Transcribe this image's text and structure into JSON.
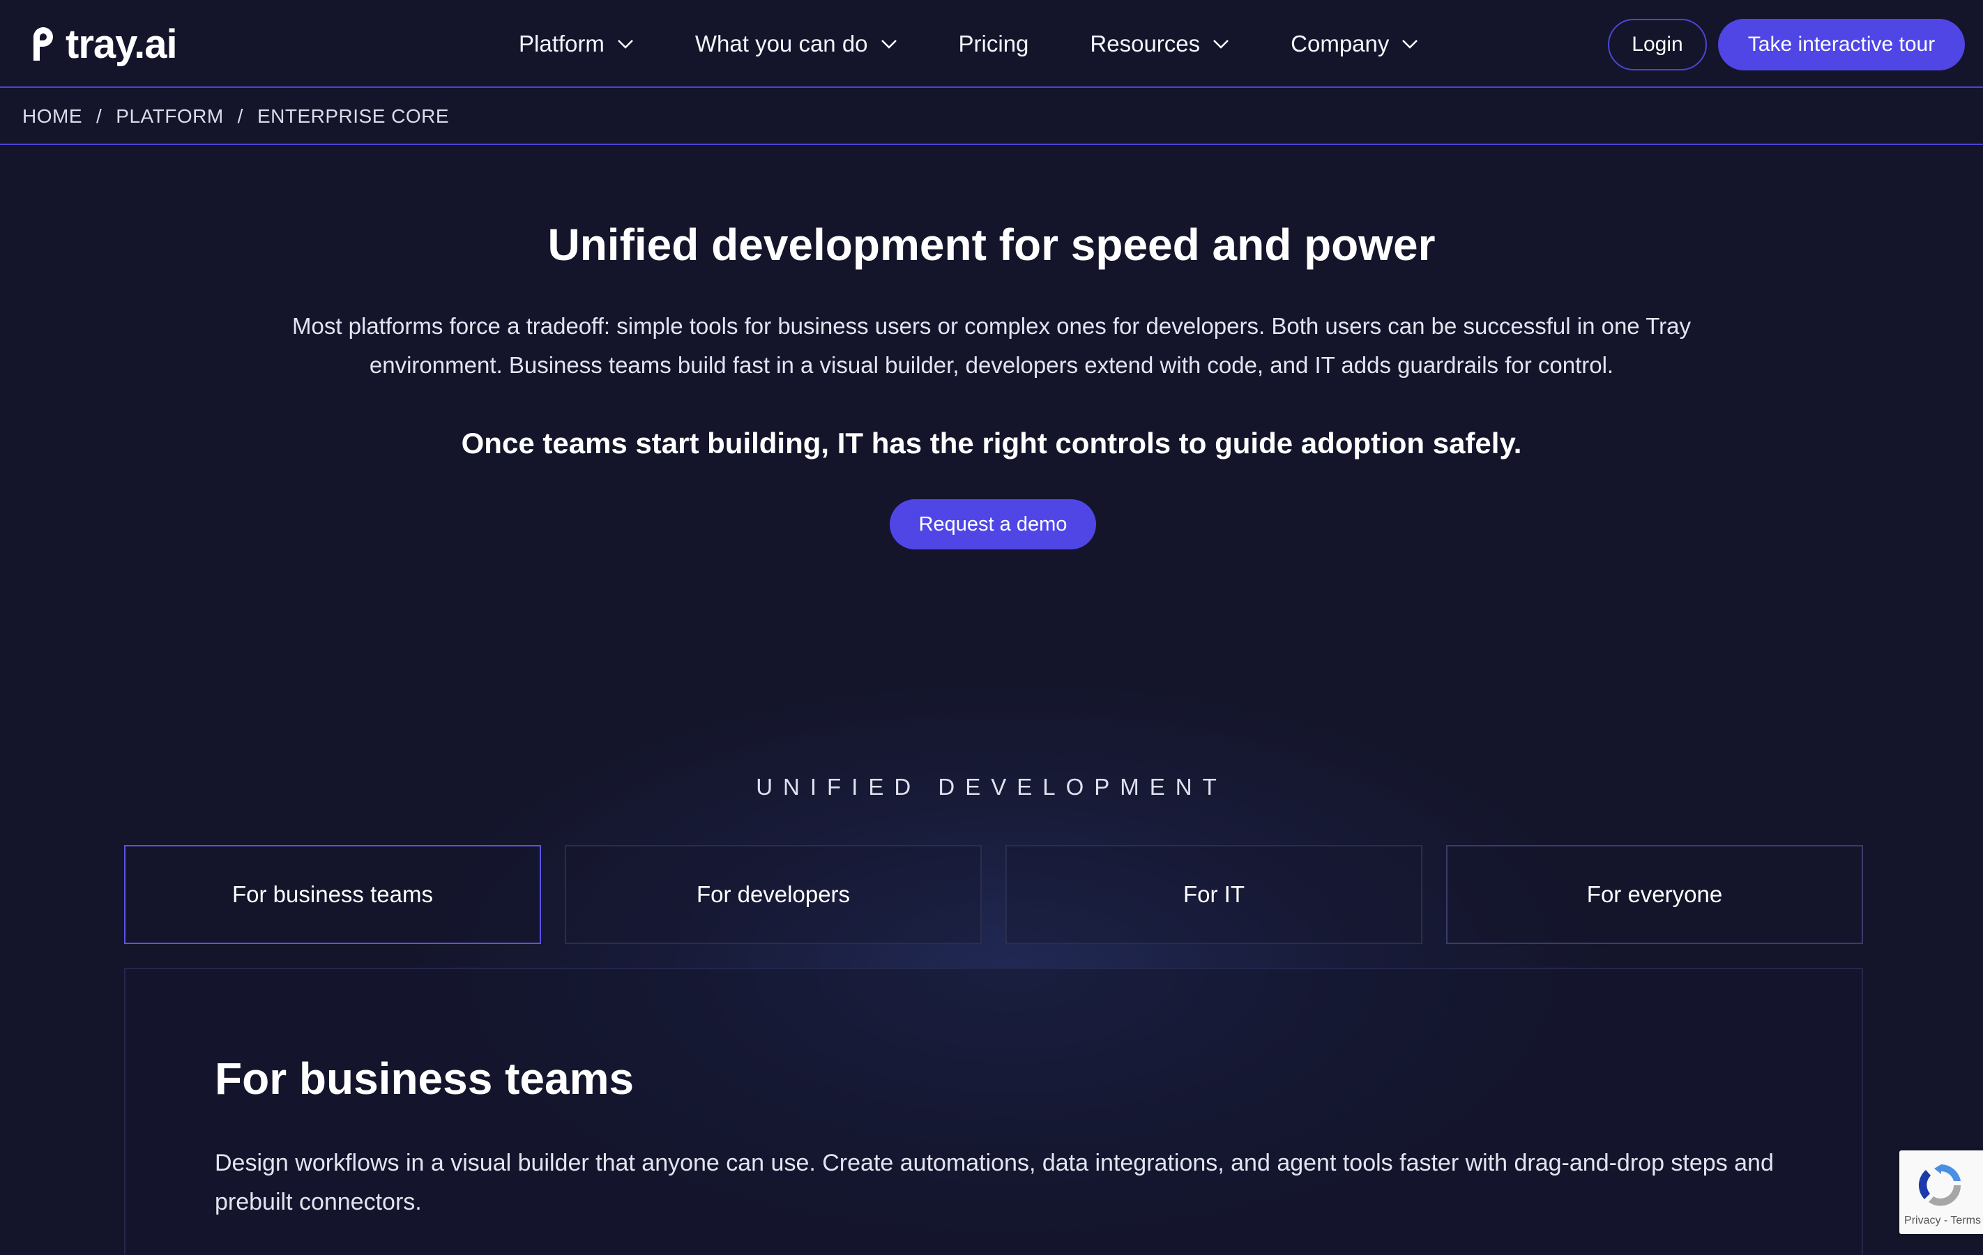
{
  "brand": {
    "name": "tray.ai",
    "logo_icon": "tray-link-icon"
  },
  "nav": {
    "items": [
      {
        "label": "Platform",
        "has_dropdown": true
      },
      {
        "label": "What you can do",
        "has_dropdown": true
      },
      {
        "label": "Pricing",
        "has_dropdown": false
      },
      {
        "label": "Resources",
        "has_dropdown": true
      },
      {
        "label": "Company",
        "has_dropdown": true
      }
    ],
    "login_label": "Login",
    "tour_label": "Take interactive tour"
  },
  "breadcrumb": {
    "items": [
      "HOME",
      "PLATFORM",
      "ENTERPRISE CORE"
    ],
    "separator": "/"
  },
  "hero": {
    "title": "Unified development for speed and power",
    "description": "Most platforms force a tradeoff: simple tools for business users or complex ones for developers. Both users can be successful in one Tray environment. Business teams build fast in a visual builder, developers extend with code, and IT adds guardrails for control.",
    "subtitle": "Once teams start building, IT has the right controls to guide adoption safely.",
    "cta_label": "Request a demo"
  },
  "unified": {
    "eyebrow": "UNIFIED DEVELOPMENT",
    "tabs": [
      {
        "label": "For business teams",
        "active": true
      },
      {
        "label": "For developers",
        "active": false
      },
      {
        "label": "For IT",
        "active": false
      },
      {
        "label": "For everyone",
        "active": false
      }
    ],
    "panel": {
      "title": "For business teams",
      "text": "Design workflows in a visual builder that anyone can use. Create automations, data integrations, and agent tools faster with drag-and-drop steps and prebuilt connectors."
    }
  },
  "recaptcha": {
    "links": "Privacy - Terms"
  },
  "colors": {
    "background": "#14152b",
    "accent": "#4f46e5",
    "divider": "#4b45d6",
    "text": "#ffffff"
  }
}
